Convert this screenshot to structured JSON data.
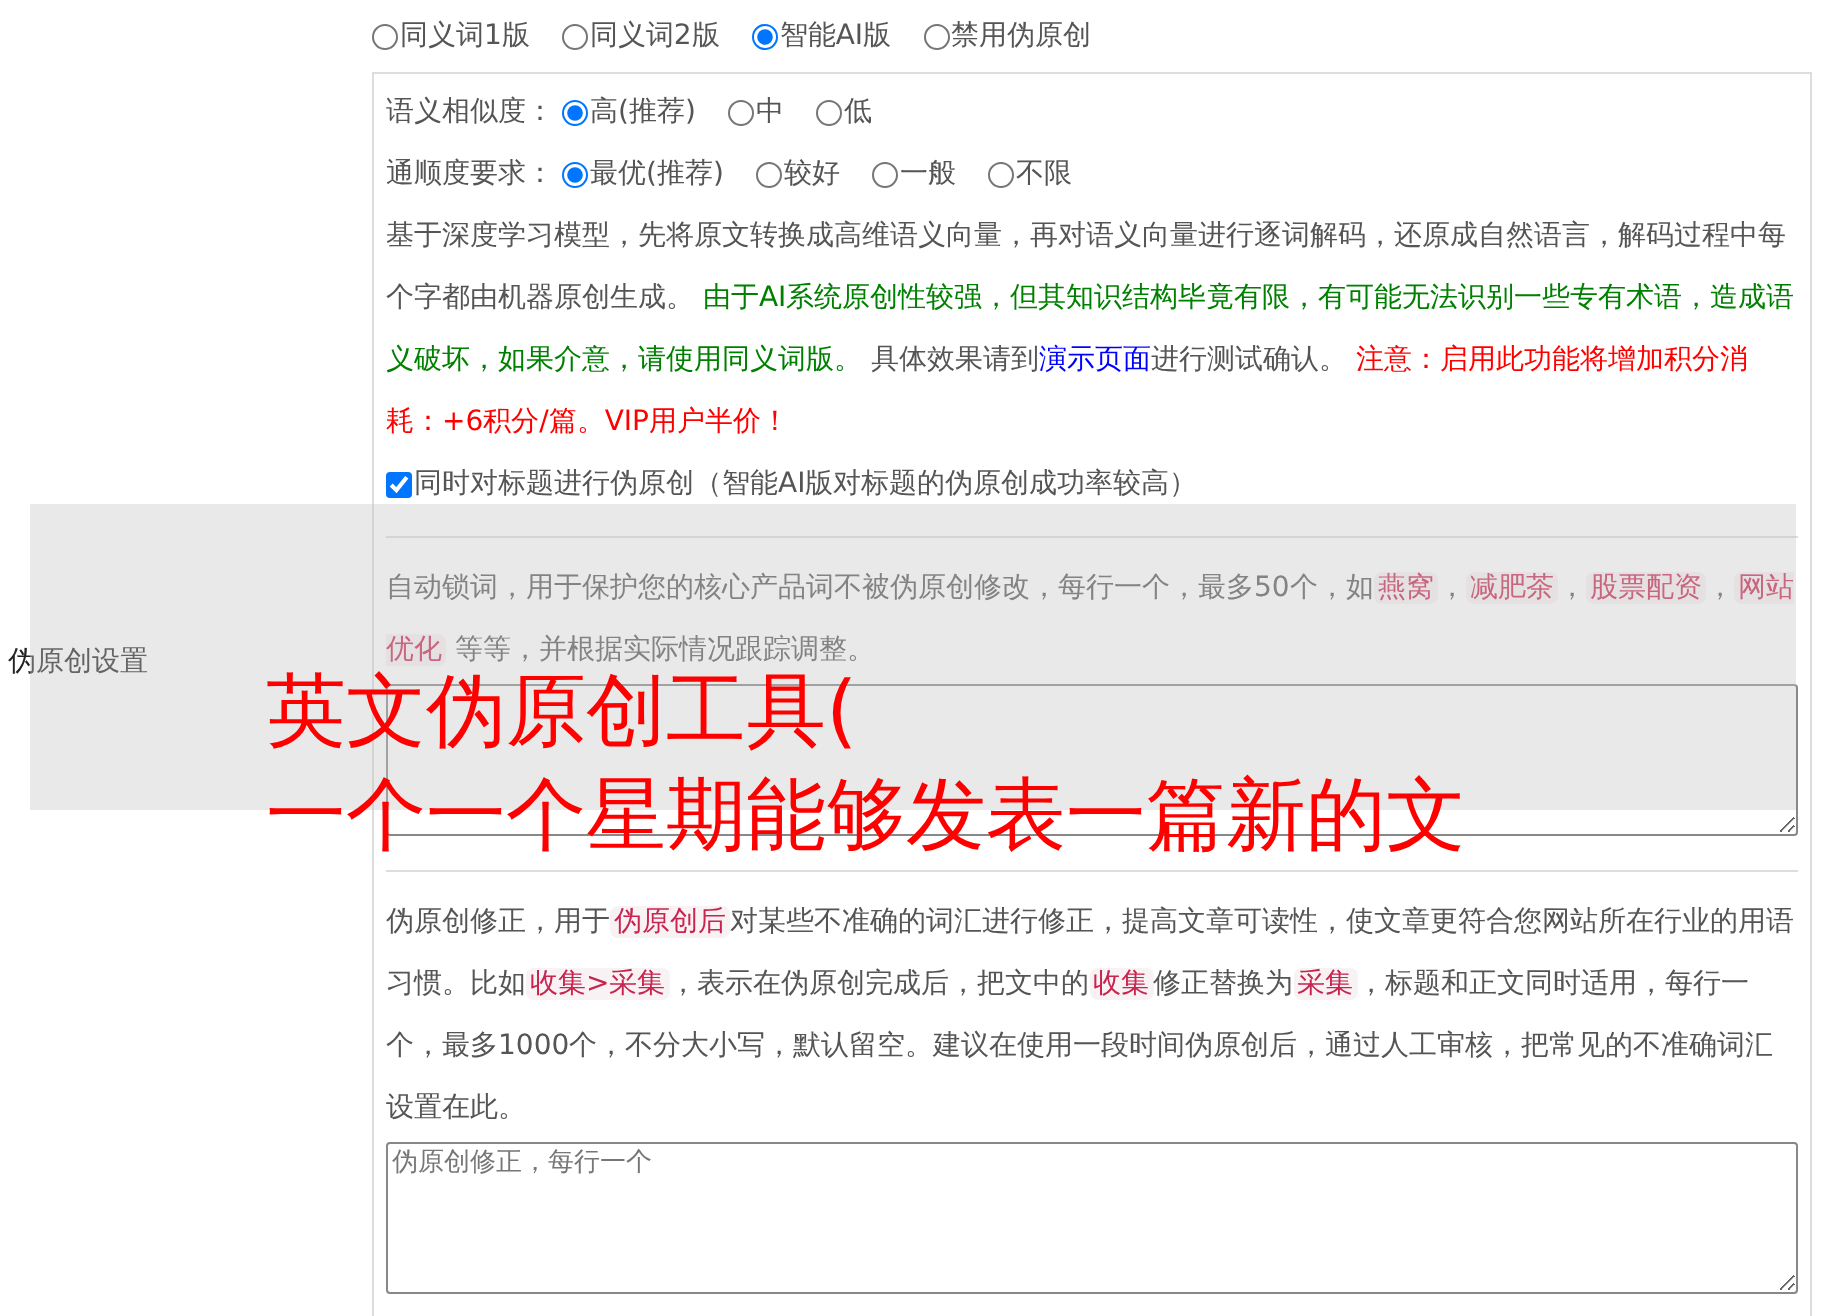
{
  "mode_options": [
    {
      "label": "同义词1版",
      "selected": false
    },
    {
      "label": "同义词2版",
      "selected": false
    },
    {
      "label": "智能AI版",
      "selected": true
    },
    {
      "label": "禁用伪原创",
      "selected": false
    }
  ],
  "section_label": "伪原创设置",
  "similarity": {
    "label": "语义相似度：",
    "options": [
      {
        "label": "高(推荐)",
        "selected": true
      },
      {
        "label": "中",
        "selected": false
      },
      {
        "label": "低",
        "selected": false
      }
    ]
  },
  "fluency": {
    "label": "通顺度要求：",
    "options": [
      {
        "label": "最优(推荐)",
        "selected": true
      },
      {
        "label": "较好",
        "selected": false
      },
      {
        "label": "一般",
        "selected": false
      },
      {
        "label": "不限",
        "selected": false
      }
    ]
  },
  "ai_description": [
    {
      "kind": "text",
      "text": "基于深度学习模型，先将原文转换成高维语义向量，再对语义向量进行逐词解码，还原成自然语言，解码过程中每个字都由机器原创生成。 "
    },
    {
      "kind": "green",
      "text": "由于AI系统原创性较强，但其知识结构毕竟有限，有可能无法识别一些专有术语，造成语义破坏，如果介意，请使用同义词版。"
    },
    {
      "kind": "text",
      "text": " 具体效果请到"
    },
    {
      "kind": "link",
      "text": "演示页面"
    },
    {
      "kind": "text",
      "text": "进行测试确认。 "
    },
    {
      "kind": "red",
      "text": "注意：启用此功能将增加积分消耗：+6积分/篇。VIP用户半价！"
    }
  ],
  "title_option": {
    "label": "同时对标题进行伪原创（智能AI版对标题的伪原创成功率较高）",
    "checked": true
  },
  "lock_words": {
    "description": [
      {
        "kind": "text",
        "text": "自动锁词，用于保护您的核心产品词不被伪原创修改，每行一个，最多50个，如"
      },
      {
        "kind": "code",
        "text": "燕窝"
      },
      {
        "kind": "text",
        "text": "，"
      },
      {
        "kind": "code",
        "text": "减肥茶"
      },
      {
        "kind": "text",
        "text": "，"
      },
      {
        "kind": "code",
        "text": "股票配资"
      },
      {
        "kind": "text",
        "text": "，"
      },
      {
        "kind": "code",
        "text": "网站优化"
      },
      {
        "kind": "text",
        "text": " 等等，并根据实际情况跟踪调整。"
      }
    ]
  },
  "correction": {
    "description": [
      {
        "kind": "text",
        "text": "伪原创修正，用于"
      },
      {
        "kind": "code",
        "text": "伪原创后"
      },
      {
        "kind": "text",
        "text": "对某些不准确的词汇进行修正，提高文章可读性，使文章更符合您网站所在行业的用语习惯。比如"
      },
      {
        "kind": "code",
        "text": "收集>采集"
      },
      {
        "kind": "text",
        "text": "，表示在伪原创完成后，把文中的"
      },
      {
        "kind": "code",
        "text": "收集"
      },
      {
        "kind": "text",
        "text": "修正替换为"
      },
      {
        "kind": "code",
        "text": "采集"
      },
      {
        "kind": "text",
        "text": "，标题和正文同时适用，每行一个，最多1000个，不分大小写，默认留空。建议在使用一段时间伪原创后，通过人工审核，把常见的不准确词汇设置在此。"
      }
    ],
    "placeholder": "伪原创修正，每行一个"
  },
  "overlay_title": [
    "英文伪原创工具(",
    "一个一个星期能够发表一篇新的文"
  ]
}
